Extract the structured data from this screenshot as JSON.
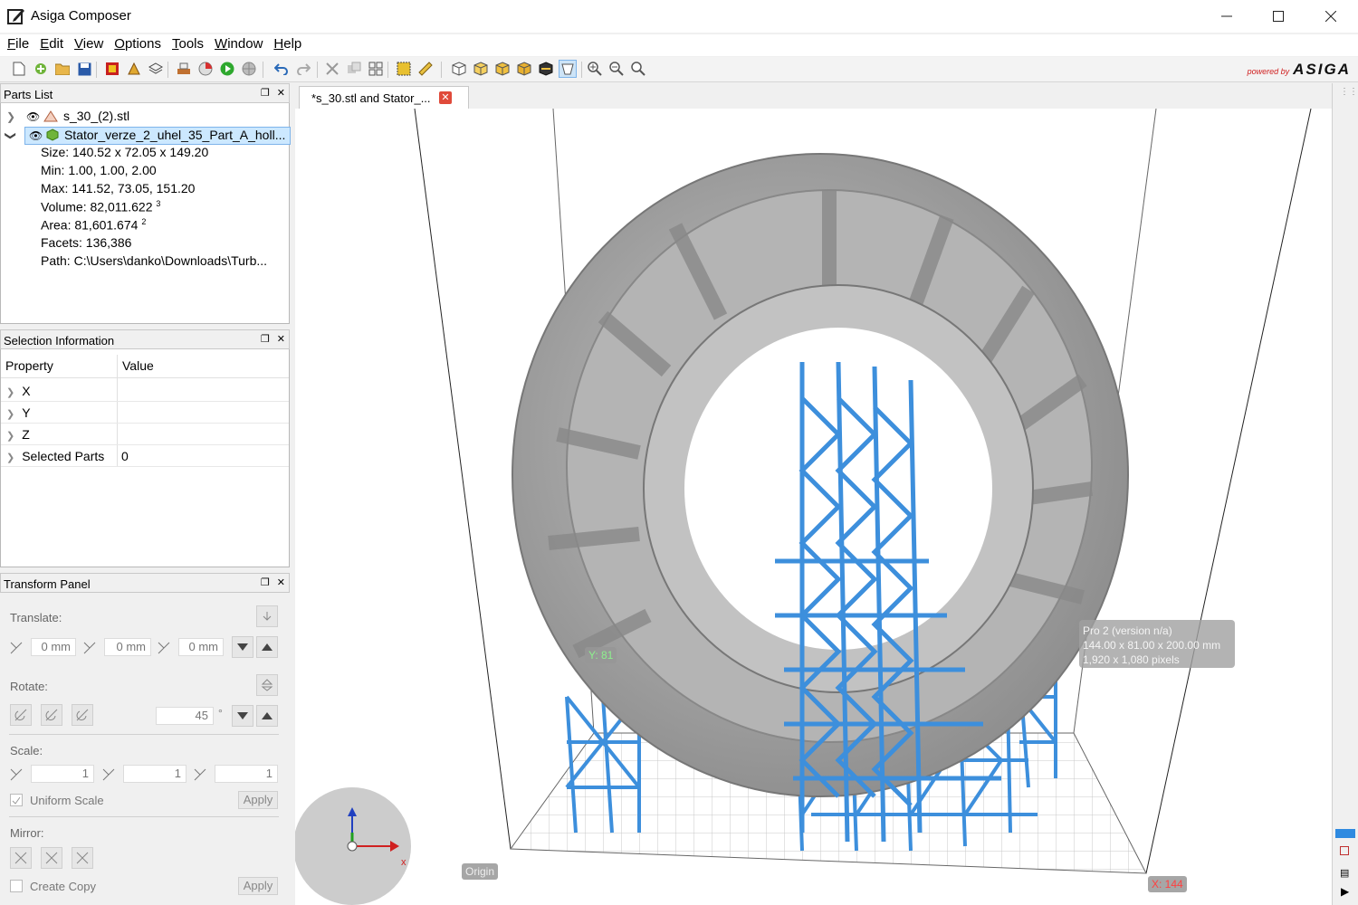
{
  "window": {
    "title": "Asiga Composer"
  },
  "menu": [
    {
      "label_u": "F",
      "label_rest": "ile"
    },
    {
      "label_u": "E",
      "label_rest": "dit"
    },
    {
      "label_u": "V",
      "label_rest": "iew"
    },
    {
      "label_u": "O",
      "label_rest": "ptions"
    },
    {
      "label_u": "T",
      "label_rest": "ools"
    },
    {
      "label_u": "W",
      "label_rest": "indow"
    },
    {
      "label_u": "H",
      "label_rest": "elp"
    }
  ],
  "brand": {
    "powered": "powered by",
    "logo": "ASIGA"
  },
  "parts_list": {
    "title": "Parts List",
    "items": [
      {
        "name": "s_30_(2).stl"
      },
      {
        "name": "Stator_verze_2_uhel_35_Part_A_holl..."
      }
    ],
    "properties": {
      "size": "Size: 140.52 x 72.05 x 149.20",
      "min": "Min: 1.00, 1.00, 2.00",
      "max": "Max: 141.52, 73.05, 151.20",
      "volume": "Volume: 82,011.622",
      "volume_unit": "3",
      "area": "Area: 81,601.674",
      "area_unit": "2",
      "facets": "Facets: 136,386",
      "path": "Path: C:\\Users\\danko\\Downloads\\Turb..."
    }
  },
  "selection_info": {
    "title": "Selection Information",
    "col_property": "Property",
    "col_value": "Value",
    "rows": [
      {
        "property": "X",
        "value": ""
      },
      {
        "property": "Y",
        "value": ""
      },
      {
        "property": "Z",
        "value": ""
      },
      {
        "property": "Selected Parts",
        "value": "0"
      }
    ]
  },
  "transform": {
    "title": "Transform Panel",
    "translate_label": "Translate:",
    "translate": {
      "x": "0 mm",
      "y": "0 mm",
      "z": "0 mm"
    },
    "rotate_label": "Rotate:",
    "rotate_value": "45",
    "degree": "°",
    "scale_label": "Scale:",
    "scale": {
      "x": "1",
      "y": "1",
      "z": "1"
    },
    "uniform_scale": "Uniform Scale",
    "apply": "Apply",
    "mirror_label": "Mirror:",
    "create_copy": "Create Copy"
  },
  "document_tab": {
    "label": "*s_30.stl and Stator_..."
  },
  "viewport": {
    "printer_info": {
      "line1": "Pro 2 (version n/a)",
      "line2": "144.00 x 81.00 x 200.00 mm",
      "line3": "1,920 x 1,080 pixels"
    },
    "y_badge": "Y: 81",
    "x_badge": "X: 144",
    "origin": "Origin"
  },
  "colors": {
    "support_blue": "#3d8fdc",
    "part_gray": "#a8a8a8",
    "accent_red": "#e04a3a"
  }
}
